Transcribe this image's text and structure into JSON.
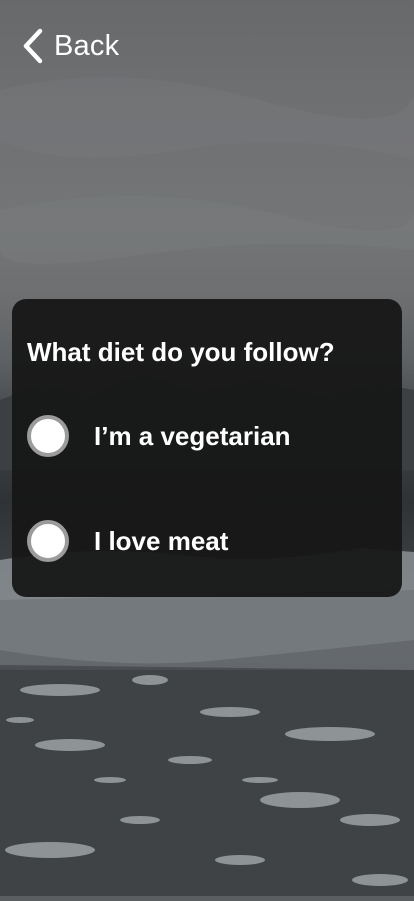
{
  "header": {
    "back_label": "Back",
    "back_icon": "chevron-left-icon"
  },
  "question": {
    "title": "What diet do you follow?",
    "options": [
      {
        "label": "I’m a vegetarian",
        "selected": false
      },
      {
        "label": "I love meat",
        "selected": false
      }
    ]
  },
  "colors": {
    "text": "#ffffff",
    "card_bg": "#161616",
    "radio_fill": "#ffffff",
    "radio_border": "#9b9b9b"
  }
}
